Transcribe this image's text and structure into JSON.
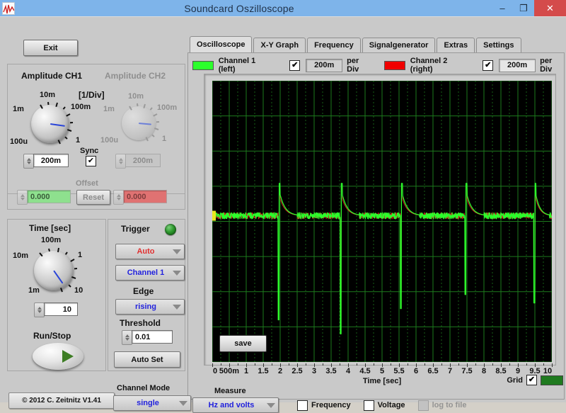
{
  "window": {
    "title": "Soundcard Oszilloscope",
    "minimize": "–",
    "maximize": "❐",
    "close": "✕"
  },
  "exit_button": "Exit",
  "tabs": [
    {
      "label": "Oscilloscope",
      "active": true
    },
    {
      "label": "X-Y Graph",
      "active": false
    },
    {
      "label": "Frequency",
      "active": false
    },
    {
      "label": "Signalgenerator",
      "active": false
    },
    {
      "label": "Extras",
      "active": false
    },
    {
      "label": "Settings",
      "active": false
    }
  ],
  "channels": {
    "ch1": {
      "label": "Channel 1 (left)",
      "color": "#2bff2b",
      "checked": true,
      "per_div_value": "200m",
      "per_div_label": "per Div"
    },
    "ch2": {
      "label": "Channel 2 (right)",
      "color": "#f00000",
      "checked": true,
      "per_div_value": "200m",
      "per_div_label": "per Div"
    }
  },
  "amplitude": {
    "ch1_title": "Amplitude CH1",
    "ch2_title": "Amplitude CH2",
    "per_div_unit": "[1/Div]",
    "knob_labels": [
      "1m",
      "10m",
      "100m",
      "1",
      "100u"
    ],
    "ch1_value": "200m",
    "ch2_value": "200m",
    "sync_label": "Sync",
    "sync_checked": true,
    "offset_label": "Offset",
    "offset_ch1": "0.000",
    "offset_ch2": "0.000",
    "reset_label": "Reset"
  },
  "time": {
    "title": "Time [sec]",
    "knob_labels": [
      "10m",
      "100m",
      "1",
      "10",
      "1m"
    ],
    "value": "10",
    "runstop_label": "Run/Stop"
  },
  "trigger": {
    "title": "Trigger",
    "mode": "Auto",
    "source": "Channel 1",
    "edge_label": "Edge",
    "edge": "rising",
    "threshold_label": "Threshold",
    "threshold": "0.01",
    "autoset_label": "Auto Set"
  },
  "footer": {
    "copyright": "© 2012  C. Zeitnitz V1.41",
    "channel_mode_label": "Channel Mode",
    "channel_mode": "single"
  },
  "scope": {
    "save_label": "save",
    "grid_label": "Grid",
    "grid_checked": true,
    "grid_color": "#1f7a1f"
  },
  "measure": {
    "label": "Measure",
    "mode": "Hz and volts",
    "frequency_label": "Frequency",
    "frequency_checked": false,
    "voltage_label": "Voltage",
    "voltage_checked": false,
    "log_to_file_label": "log to file",
    "log_to_file_enabled": false
  },
  "chart_data": {
    "type": "line",
    "title": "",
    "xlabel": "Time [sec]",
    "ylabel": "",
    "xlim": [
      0,
      10
    ],
    "ylim": [
      -5,
      5
    ],
    "grid": true,
    "x_ticks": [
      0,
      0.5,
      1,
      1.5,
      2,
      2.5,
      3,
      3.5,
      4,
      4.5,
      5,
      5.5,
      6,
      6.5,
      7,
      7.5,
      8,
      8.5,
      9,
      9.5,
      10
    ],
    "x_tick_labels": [
      "0",
      "500m",
      "1",
      "1.5",
      "2",
      "2.5",
      "3",
      "3.5",
      "4",
      "4.5",
      "5",
      "5.5",
      "6",
      "6.5",
      "7",
      "7.5",
      "8",
      "8.5",
      "9",
      "9.5",
      "10"
    ],
    "y_major_divisions": 8,
    "baseline_y": 0.2,
    "series": [
      {
        "name": "Channel 1 (left)",
        "color": "#2bff2b",
        "spikes": [
          {
            "t": 1.95,
            "peak": 0.95,
            "trough": -3.5,
            "decay": 0.55
          },
          {
            "t": 3.78,
            "peak": 0.95,
            "trough": -4.0,
            "decay": 0.55
          },
          {
            "t": 5.55,
            "peak": 0.95,
            "trough": -3.1,
            "decay": 0.55
          },
          {
            "t": 7.45,
            "peak": 0.95,
            "trough": -2.6,
            "decay": 0.55
          },
          {
            "t": 9.48,
            "peak": 0.95,
            "trough": -2.9,
            "decay": 0.45
          }
        ]
      },
      {
        "name": "Channel 2 (right)",
        "color": "#d02020",
        "spikes": [
          {
            "t": 1.95,
            "peak": 0.8,
            "trough": -3.5,
            "decay": 0.55
          },
          {
            "t": 3.78,
            "peak": 0.8,
            "trough": -4.0,
            "decay": 0.55
          },
          {
            "t": 5.55,
            "peak": 0.8,
            "trough": -3.1,
            "decay": 0.55
          },
          {
            "t": 7.45,
            "peak": 0.8,
            "trough": -2.6,
            "decay": 0.55
          },
          {
            "t": 9.48,
            "peak": 0.8,
            "trough": -2.9,
            "decay": 0.45
          }
        ]
      }
    ],
    "cursor_marker": {
      "color": "#e8e820",
      "t": 0.0
    }
  }
}
